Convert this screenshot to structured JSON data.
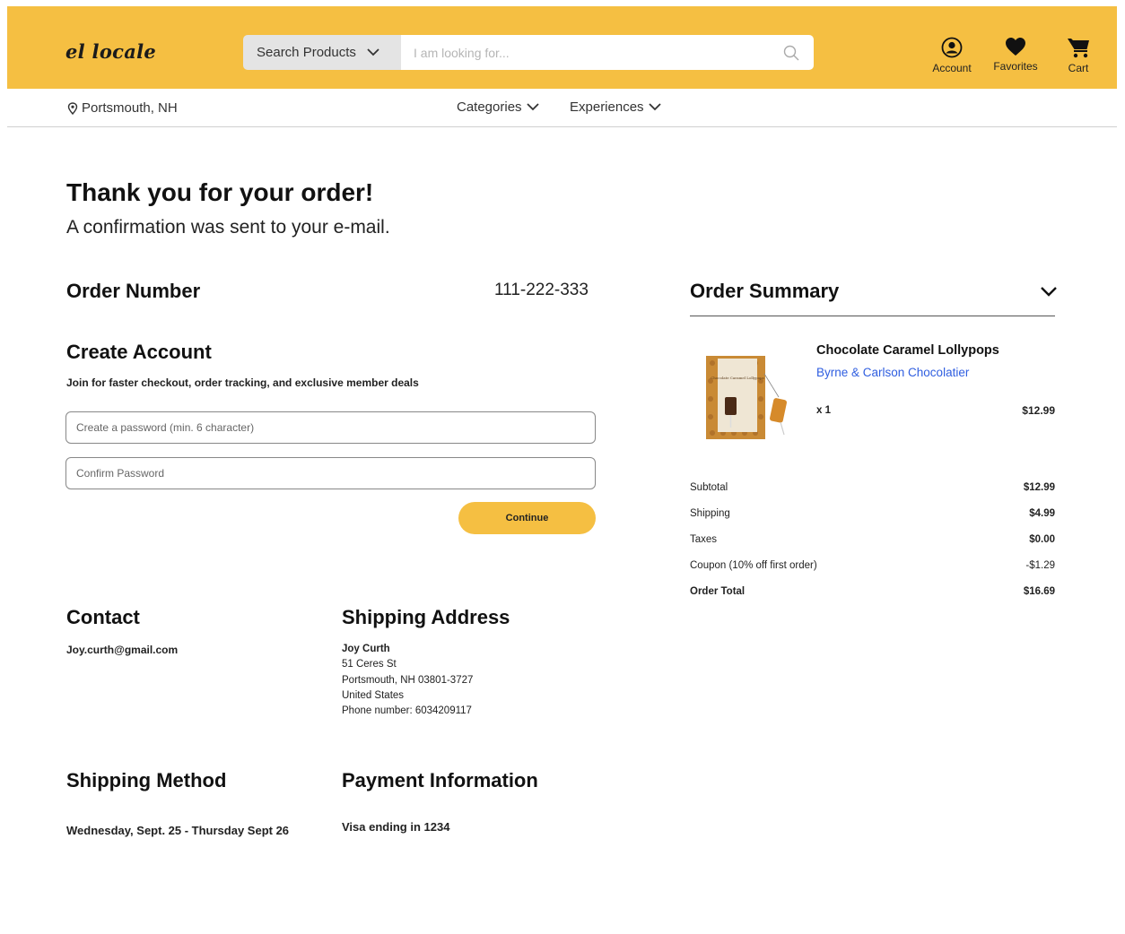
{
  "header": {
    "logo": "el locale",
    "search_category": "Search Products",
    "search_placeholder": "I am looking for...",
    "account_label": "Account",
    "favorites_label": "Favorites",
    "cart_label": "Cart"
  },
  "subnav": {
    "location": "Portsmouth, NH",
    "categories": "Categories",
    "experiences": "Experiences"
  },
  "confirmation": {
    "title": "Thank you for your order!",
    "subtitle": "A confirmation was sent to your e-mail."
  },
  "order": {
    "label": "Order Number",
    "number": "111-222-333"
  },
  "create_account": {
    "title": "Create Account",
    "description": "Join for faster checkout, order tracking, and exclusive member deals",
    "password_placeholder": "Create a password (min. 6 character)",
    "confirm_placeholder": "Confirm Password",
    "continue_label": "Continue"
  },
  "contact": {
    "title": "Contact",
    "email": "Joy.curth@gmail.com"
  },
  "shipping_address": {
    "title": "Shipping Address",
    "name": "Joy Curth",
    "street": "51 Ceres St",
    "city": "Portsmouth, NH 03801-3727",
    "country": "United States",
    "phone": "Phone number: 6034209117"
  },
  "shipping_method": {
    "title": "Shipping Method",
    "value": "Wednesday, Sept. 25 - Thursday Sept 26"
  },
  "payment": {
    "title": "Payment Information",
    "value": "Visa ending in 1234"
  },
  "summary": {
    "title": "Order Summary",
    "item": {
      "name": "Chocolate Caramel Lollypops",
      "vendor": "Byrne & Carlson Chocolatier",
      "quantity": "x 1",
      "price": "$12.99",
      "box_text": "Chocolate Caramel Lollypops"
    },
    "totals": [
      {
        "label": "Subtotal",
        "value": "$12.99"
      },
      {
        "label": "Shipping",
        "value": "$4.99"
      },
      {
        "label": "Taxes",
        "value": "$0.00"
      },
      {
        "label": "Coupon (10% off first order)",
        "value": "-$1.29"
      },
      {
        "label": "Order Total",
        "value": "$16.69"
      }
    ]
  },
  "colors": {
    "brand_yellow": "#f5bf42",
    "link_blue": "#2f5ee0"
  }
}
